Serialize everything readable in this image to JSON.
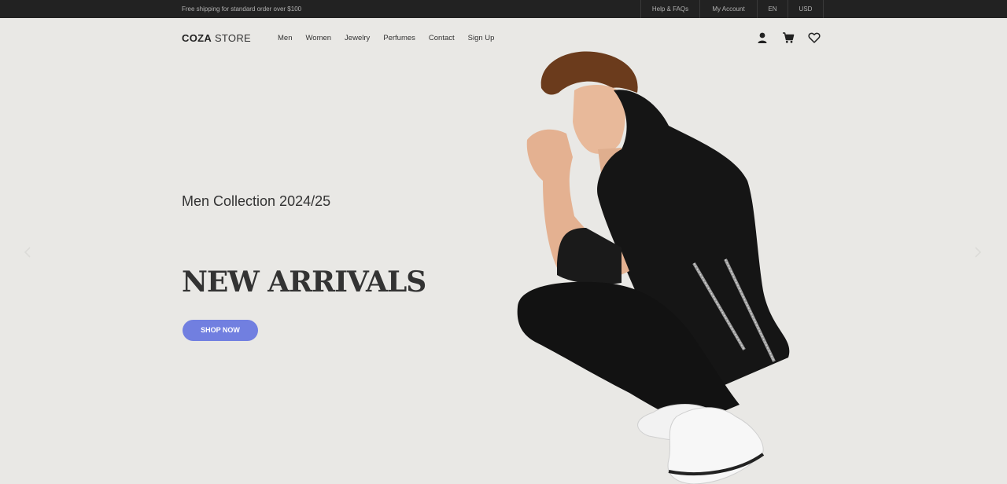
{
  "topbar": {
    "promo": "Free shipping for standard order over $100",
    "links": [
      "Help & FAQs",
      "My Account",
      "EN",
      "USD"
    ]
  },
  "header": {
    "logo_bold": "COZA",
    "logo_rest": " STORE",
    "nav": [
      "Men",
      "Women",
      "Jewelry",
      "Perfumes",
      "Contact",
      "Sign Up"
    ],
    "icons": [
      "user-icon",
      "cart-icon",
      "heart-icon"
    ]
  },
  "hero": {
    "subtitle": "Men Collection 2024/25",
    "headline": "NEW ARRIVALS",
    "button": "SHOP NOW"
  },
  "colors": {
    "topbar_bg": "#222222",
    "page_bg": "#e9e8e5",
    "accent": "#717fe0"
  }
}
